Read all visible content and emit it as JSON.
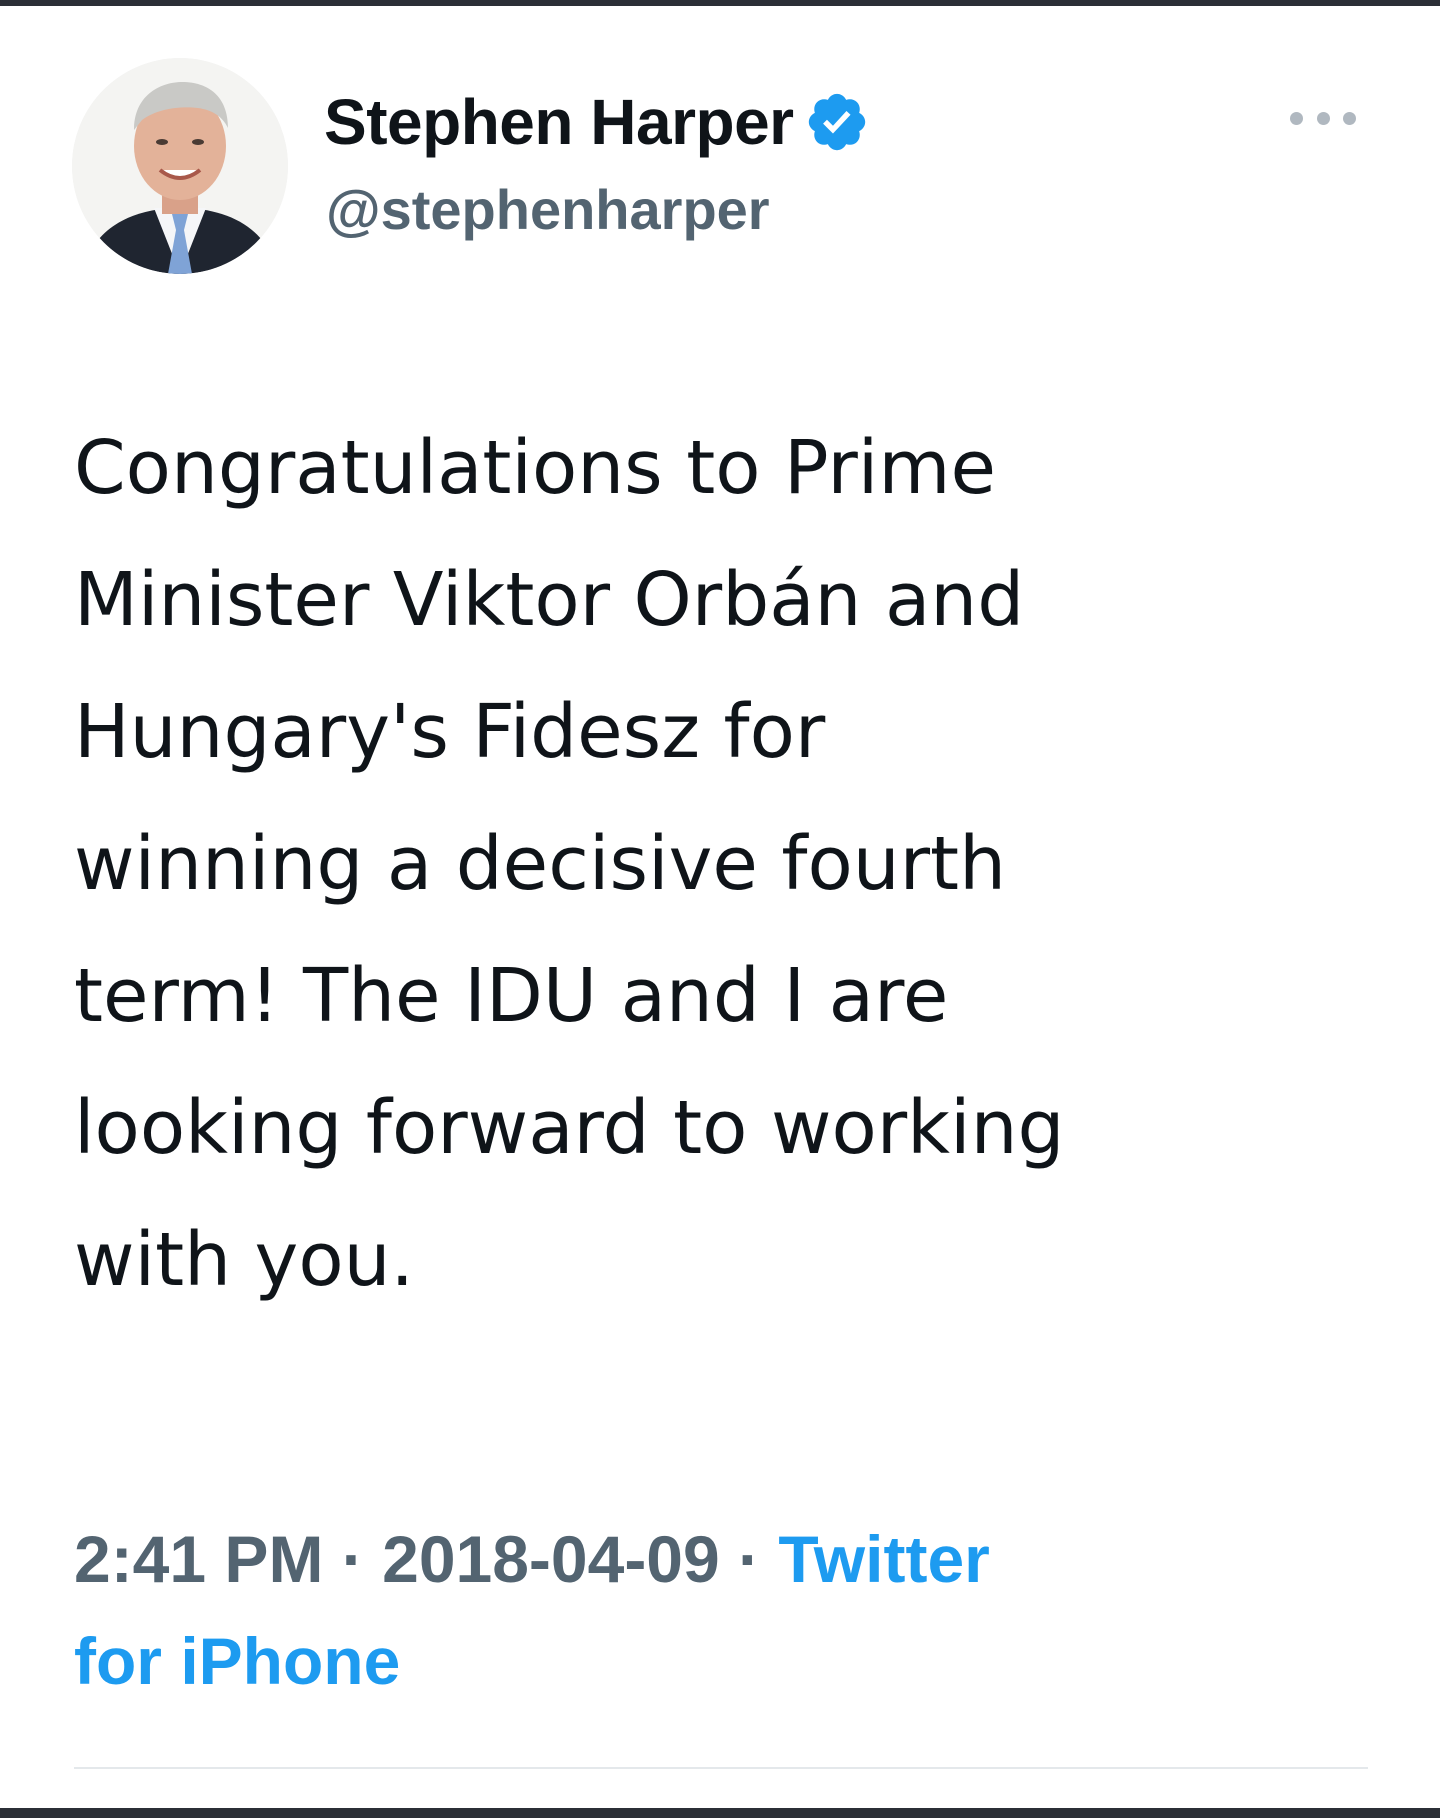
{
  "tweet": {
    "author": {
      "display_name": "Stephen Harper",
      "handle": "@stephenharper",
      "verified": true,
      "avatar_icon": "profile-photo"
    },
    "more_icon": "more-horizontal-icon",
    "text_lines": [
      "Congratulations to Prime",
      "Minister Viktor Orbán and",
      "Hungary's Fidesz for",
      "winning a decisive fourth",
      "term! The IDU and I are",
      "looking forward to working",
      "with you."
    ],
    "meta": {
      "time": "2:41 PM",
      "separator": "·",
      "date": "2018-04-09",
      "source_line1": "Twitter",
      "source_line2": "for iPhone"
    }
  },
  "colors": {
    "verified_badge": "#1d9bf0",
    "link": "#1d9bf0",
    "secondary_text": "#536471",
    "primary_text": "#0f1419",
    "frame_bar": "#2b2f36"
  }
}
